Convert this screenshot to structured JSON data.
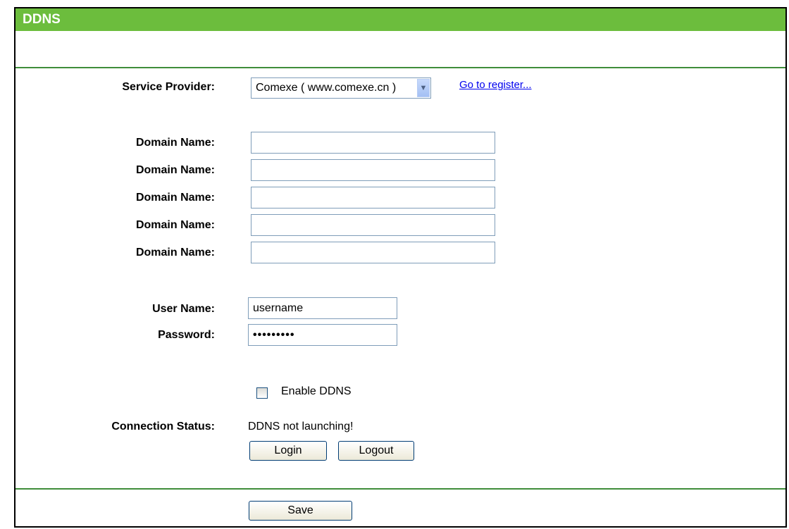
{
  "page": {
    "title": "DDNS"
  },
  "service_provider": {
    "label": "Service Provider:",
    "selected": "Comexe ( www.comexe.cn )",
    "register_link": "Go to register..."
  },
  "domains": {
    "label": "Domain Name:",
    "values": [
      "",
      "",
      "",
      "",
      ""
    ]
  },
  "account": {
    "username_label": "User Name:",
    "username_value": "username",
    "password_label": "Password:",
    "password_value": "•••••••••"
  },
  "enable": {
    "label": "Enable DDNS",
    "checked": false
  },
  "status": {
    "label": "Connection Status:",
    "value": "DDNS not launching!"
  },
  "buttons": {
    "login": "Login",
    "logout": "Logout",
    "save": "Save"
  },
  "colors": {
    "header_green": "#6cbd3d",
    "divider_green": "#3f8d3a"
  }
}
